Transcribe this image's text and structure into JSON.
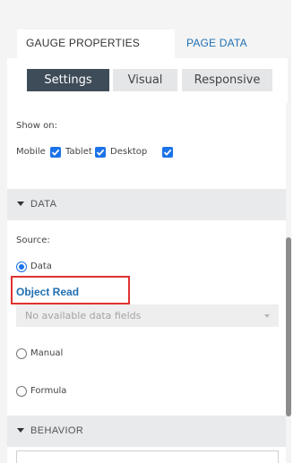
{
  "tabs": [
    {
      "label": "GAUGE PROPERTIES",
      "active": true
    },
    {
      "label": "PAGE DATA",
      "active": false
    }
  ],
  "view_buttons": {
    "settings": "Settings",
    "visual": "Visual",
    "responsive": "Responsive",
    "selected": "Settings"
  },
  "show_on": {
    "label": "Show on:",
    "options": [
      {
        "label": "Mobile",
        "checked": true
      },
      {
        "label": "Tablet",
        "checked": true
      },
      {
        "label": "Desktop",
        "checked": true
      }
    ]
  },
  "data_section": {
    "title": "DATA",
    "source_label": "Source:",
    "options": [
      {
        "label": "Data",
        "selected": true
      },
      {
        "label": "Manual",
        "selected": false
      },
      {
        "label": "Formula",
        "selected": false
      }
    ],
    "object_read_label": "Object Read",
    "field_select_placeholder": "No available data fields"
  },
  "behavior_section": {
    "title": "BEHAVIOR"
  },
  "colors": {
    "accent": "#1a73e8",
    "link": "#1f6fb2",
    "highlight": "#e0312f",
    "active_button": "#3e4c59"
  }
}
